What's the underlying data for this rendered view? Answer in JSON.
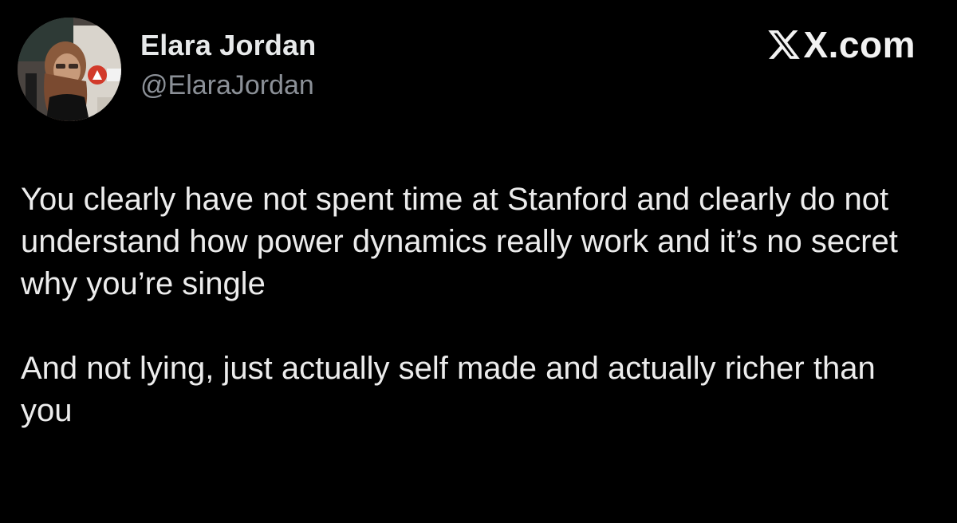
{
  "author": {
    "name": "Elara Jordan",
    "handle": "@ElaraJordan"
  },
  "watermark": {
    "text": "X.com",
    "icon": "x-logo-icon"
  },
  "tweet": {
    "paragraphs": [
      "You clearly have not spent time at Stanford and clearly do not understand how power dynamics really work and it’s no secret why you’re single",
      "And not lying, just actually self made and actually richer than you"
    ]
  },
  "colors": {
    "background": "#000000",
    "name_text": "#e7e9ea",
    "handle_text": "#8b9097",
    "body_text": "#ececec"
  }
}
